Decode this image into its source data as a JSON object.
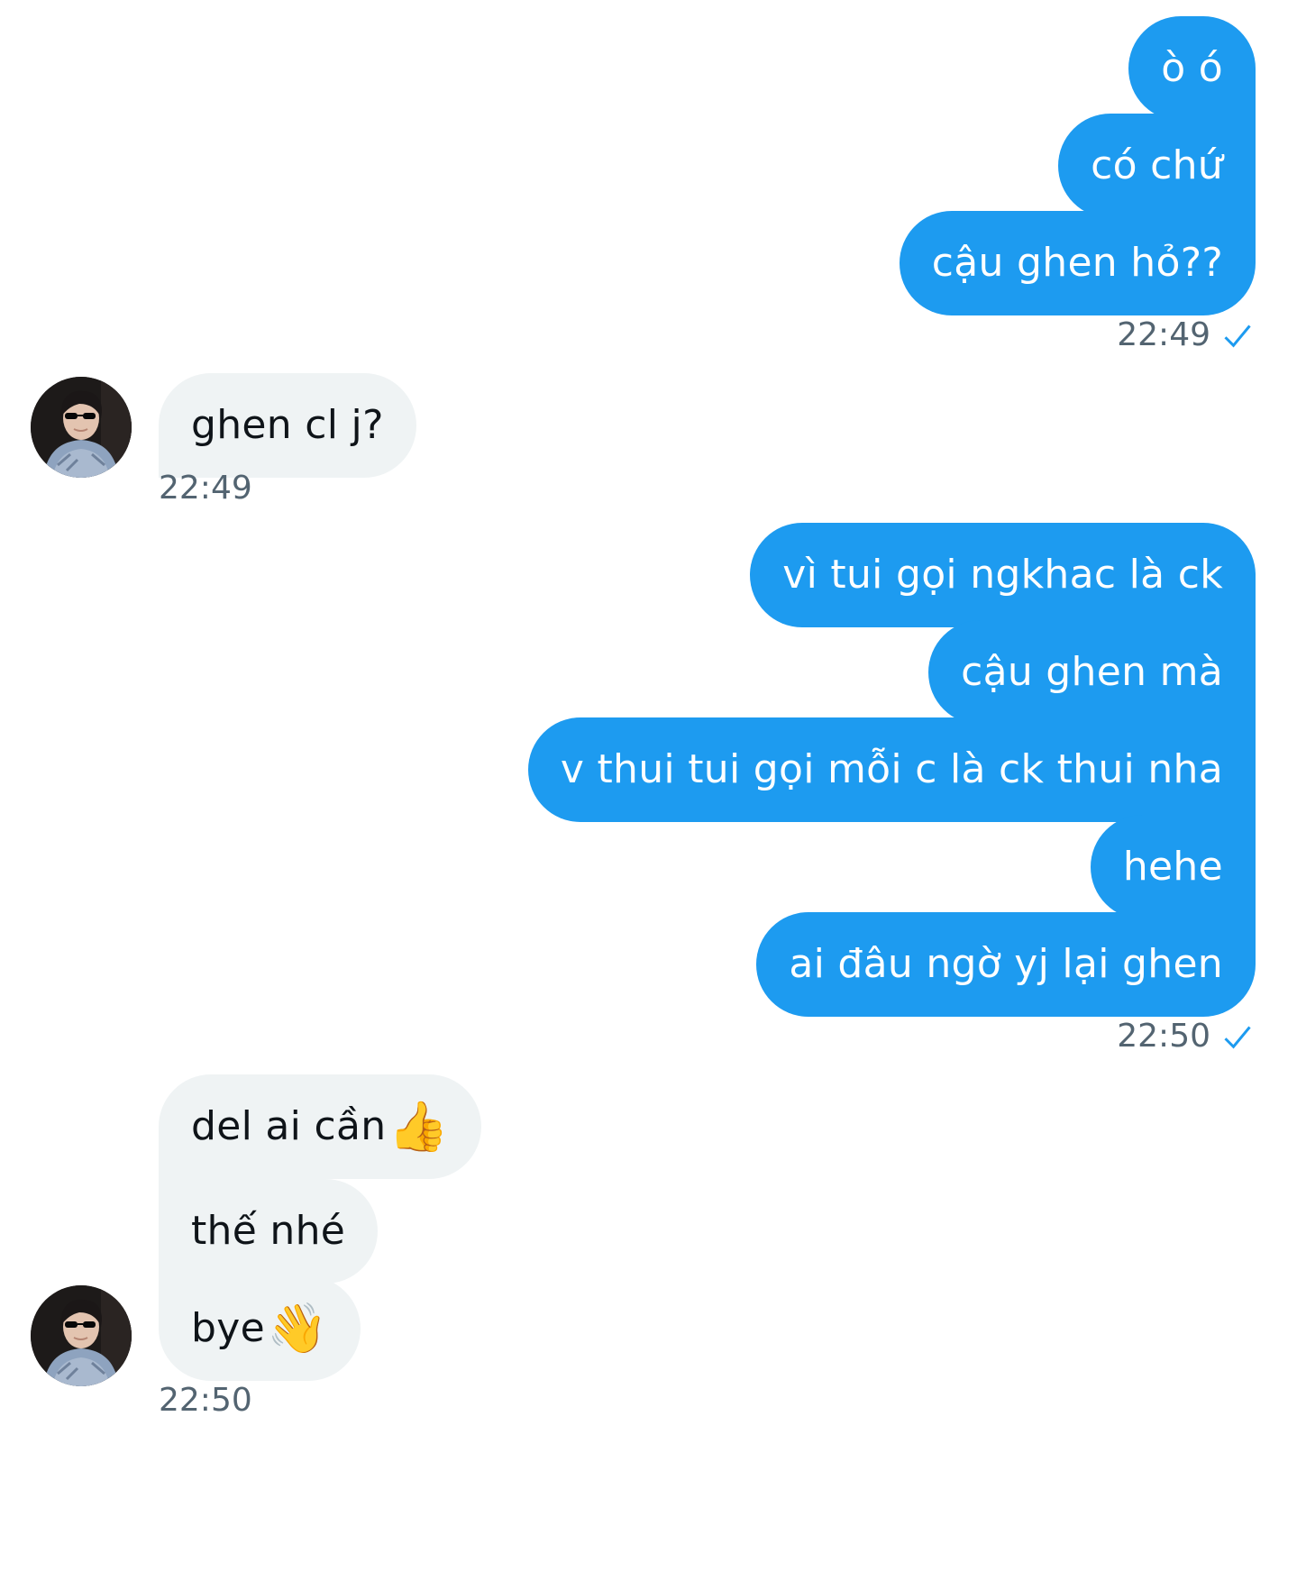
{
  "outgoing_group_1": {
    "messages": [
      "ò ó",
      "có chứ",
      "cậu ghen hỏ??"
    ],
    "time": "22:49"
  },
  "incoming_group_1": {
    "messages": [
      "ghen cl j?"
    ],
    "time": "22:49"
  },
  "outgoing_group_2": {
    "messages": [
      "vì tui gọi ngkhac là ck",
      "cậu ghen mà",
      "v thui tui gọi mỗi c là ck thui nha",
      "hehe",
      "ai đâu ngờ yj lại ghen"
    ],
    "time": "22:50"
  },
  "incoming_group_2": {
    "messages": [
      {
        "text": "del ai cần",
        "emoji": "👍",
        "emoji_name": "thumbs-up-icon"
      },
      {
        "text": "thế nhé"
      },
      {
        "text": "bye",
        "emoji": "👋",
        "emoji_name": "waving-hand-icon"
      }
    ],
    "time": "22:50"
  },
  "icons": {
    "read_receipt": "check-icon",
    "avatar": "profile-avatar"
  },
  "colors": {
    "outgoing_bubble": "#1d9bf0",
    "incoming_bubble": "#eff3f4",
    "timestamp": "#536471",
    "checkmark": "#1d9bf0"
  }
}
